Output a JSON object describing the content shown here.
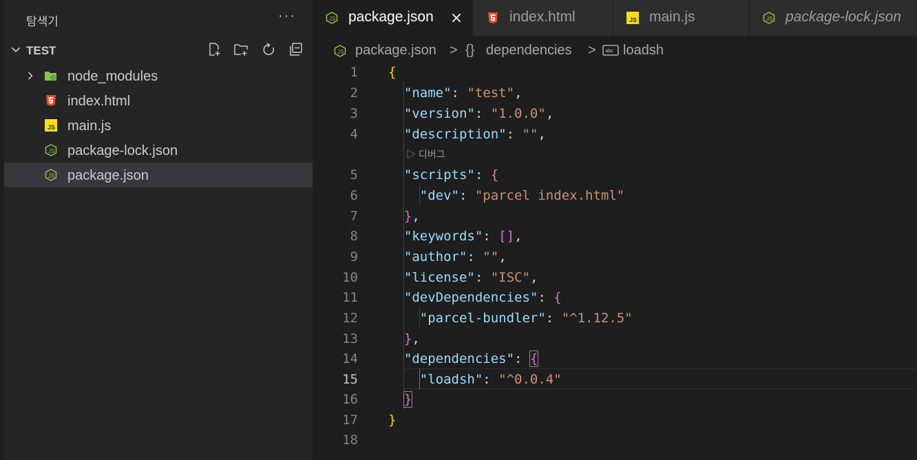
{
  "explorer": {
    "header": "탐색기",
    "more": "···",
    "section_title": "TEST",
    "files": [
      {
        "name": "node_modules",
        "type": "folder"
      },
      {
        "name": "index.html",
        "type": "html"
      },
      {
        "name": "main.js",
        "type": "js"
      },
      {
        "name": "package-lock.json",
        "type": "json"
      },
      {
        "name": "package.json",
        "type": "json",
        "selected": true
      }
    ]
  },
  "tabs": [
    {
      "label": "package.json",
      "active": true
    },
    {
      "label": "index.html"
    },
    {
      "label": "main.js"
    },
    {
      "label": "package-lock.json",
      "italic": true
    }
  ],
  "breadcrumb": {
    "file": "package.json",
    "sep": ">",
    "obj_icon": "{}",
    "obj": "dependencies",
    "prop": "loadsh"
  },
  "codelens": "▷ 디버그",
  "editor": {
    "active_line": "15",
    "line_numbers": [
      "1",
      "2",
      "3",
      "4",
      "5",
      "6",
      "7",
      "8",
      "9",
      "10",
      "11",
      "12",
      "13",
      "14",
      "15",
      "16",
      "17",
      "18"
    ],
    "tokens": {
      "l2k": "\"name\"",
      "l2v": "\"test\"",
      "l3k": "\"version\"",
      "l3v": "\"1.0.0\"",
      "l4k": "\"description\"",
      "l4v": "\"\"",
      "l5k": "\"scripts\"",
      "l6k": "\"dev\"",
      "l6v": "\"parcel index.html\"",
      "l8k": "\"keywords\"",
      "l8v": "[]",
      "l9k": "\"author\"",
      "l9v": "\"\"",
      "l10k": "\"license\"",
      "l10v": "\"ISC\"",
      "l11k": "\"devDependencies\"",
      "l12k": "\"parcel-bundler\"",
      "l12v": "\"^1.12.5\"",
      "l14k": "\"dependencies\"",
      "l15k": "\"loadsh\"",
      "l15v": "\"^0.0.4\""
    }
  },
  "colors": {
    "sidebar_bg": "#252526",
    "editor_bg": "#1e1e1e",
    "json_icon": "#8dc149",
    "html_icon": "#e44d26",
    "js_icon": "#f5de19",
    "key": "#9cdcfe",
    "string": "#ce9178",
    "bracket_level1": "#ffd700",
    "bracket_level2": "#da70d6"
  }
}
